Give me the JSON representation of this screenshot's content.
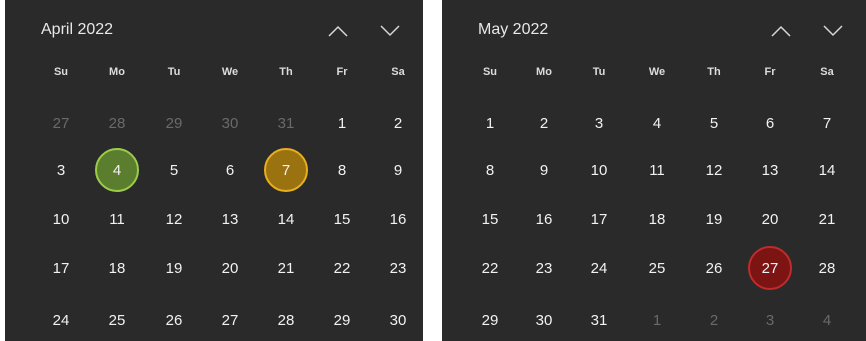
{
  "weekdays": [
    "Su",
    "Mo",
    "Tu",
    "We",
    "Th",
    "Fr",
    "Sa"
  ],
  "calendars": [
    {
      "title": "April 2022",
      "weeks": [
        [
          {
            "d": "27",
            "out": true
          },
          {
            "d": "28",
            "out": true
          },
          {
            "d": "29",
            "out": true
          },
          {
            "d": "30",
            "out": true
          },
          {
            "d": "31",
            "out": true
          },
          {
            "d": "1"
          },
          {
            "d": "2"
          }
        ],
        [
          {
            "d": "3"
          },
          {
            "d": "4",
            "hl": "green"
          },
          {
            "d": "5"
          },
          {
            "d": "6"
          },
          {
            "d": "7",
            "hl": "amber"
          },
          {
            "d": "8"
          },
          {
            "d": "9"
          }
        ],
        [
          {
            "d": "10"
          },
          {
            "d": "11"
          },
          {
            "d": "12"
          },
          {
            "d": "13"
          },
          {
            "d": "14"
          },
          {
            "d": "15"
          },
          {
            "d": "16"
          }
        ],
        [
          {
            "d": "17"
          },
          {
            "d": "18"
          },
          {
            "d": "19"
          },
          {
            "d": "20"
          },
          {
            "d": "21"
          },
          {
            "d": "22"
          },
          {
            "d": "23"
          }
        ],
        [
          {
            "d": "24"
          },
          {
            "d": "25"
          },
          {
            "d": "26"
          },
          {
            "d": "27"
          },
          {
            "d": "28"
          },
          {
            "d": "29"
          },
          {
            "d": "30"
          }
        ]
      ]
    },
    {
      "title": "May 2022",
      "weeks": [
        [
          {
            "d": "1"
          },
          {
            "d": "2"
          },
          {
            "d": "3"
          },
          {
            "d": "4"
          },
          {
            "d": "5"
          },
          {
            "d": "6"
          },
          {
            "d": "7"
          }
        ],
        [
          {
            "d": "8"
          },
          {
            "d": "9"
          },
          {
            "d": "10"
          },
          {
            "d": "11"
          },
          {
            "d": "12"
          },
          {
            "d": "13"
          },
          {
            "d": "14"
          }
        ],
        [
          {
            "d": "15"
          },
          {
            "d": "16"
          },
          {
            "d": "17"
          },
          {
            "d": "18"
          },
          {
            "d": "19"
          },
          {
            "d": "20"
          },
          {
            "d": "21"
          }
        ],
        [
          {
            "d": "22"
          },
          {
            "d": "23"
          },
          {
            "d": "24"
          },
          {
            "d": "25"
          },
          {
            "d": "26"
          },
          {
            "d": "27",
            "hl": "red"
          },
          {
            "d": "28"
          }
        ],
        [
          {
            "d": "29"
          },
          {
            "d": "30"
          },
          {
            "d": "31"
          },
          {
            "d": "1",
            "out": true
          },
          {
            "d": "2",
            "out": true
          },
          {
            "d": "3",
            "out": true
          },
          {
            "d": "4",
            "out": true
          }
        ]
      ]
    }
  ],
  "icons": {
    "previous": "chevron-up-icon",
    "next": "chevron-down-icon"
  },
  "colors": {
    "background": "#2a2a2a",
    "green_highlight": "#9ccc4a",
    "amber_highlight": "#e8b01e",
    "red_highlight": "#c02b2b"
  }
}
